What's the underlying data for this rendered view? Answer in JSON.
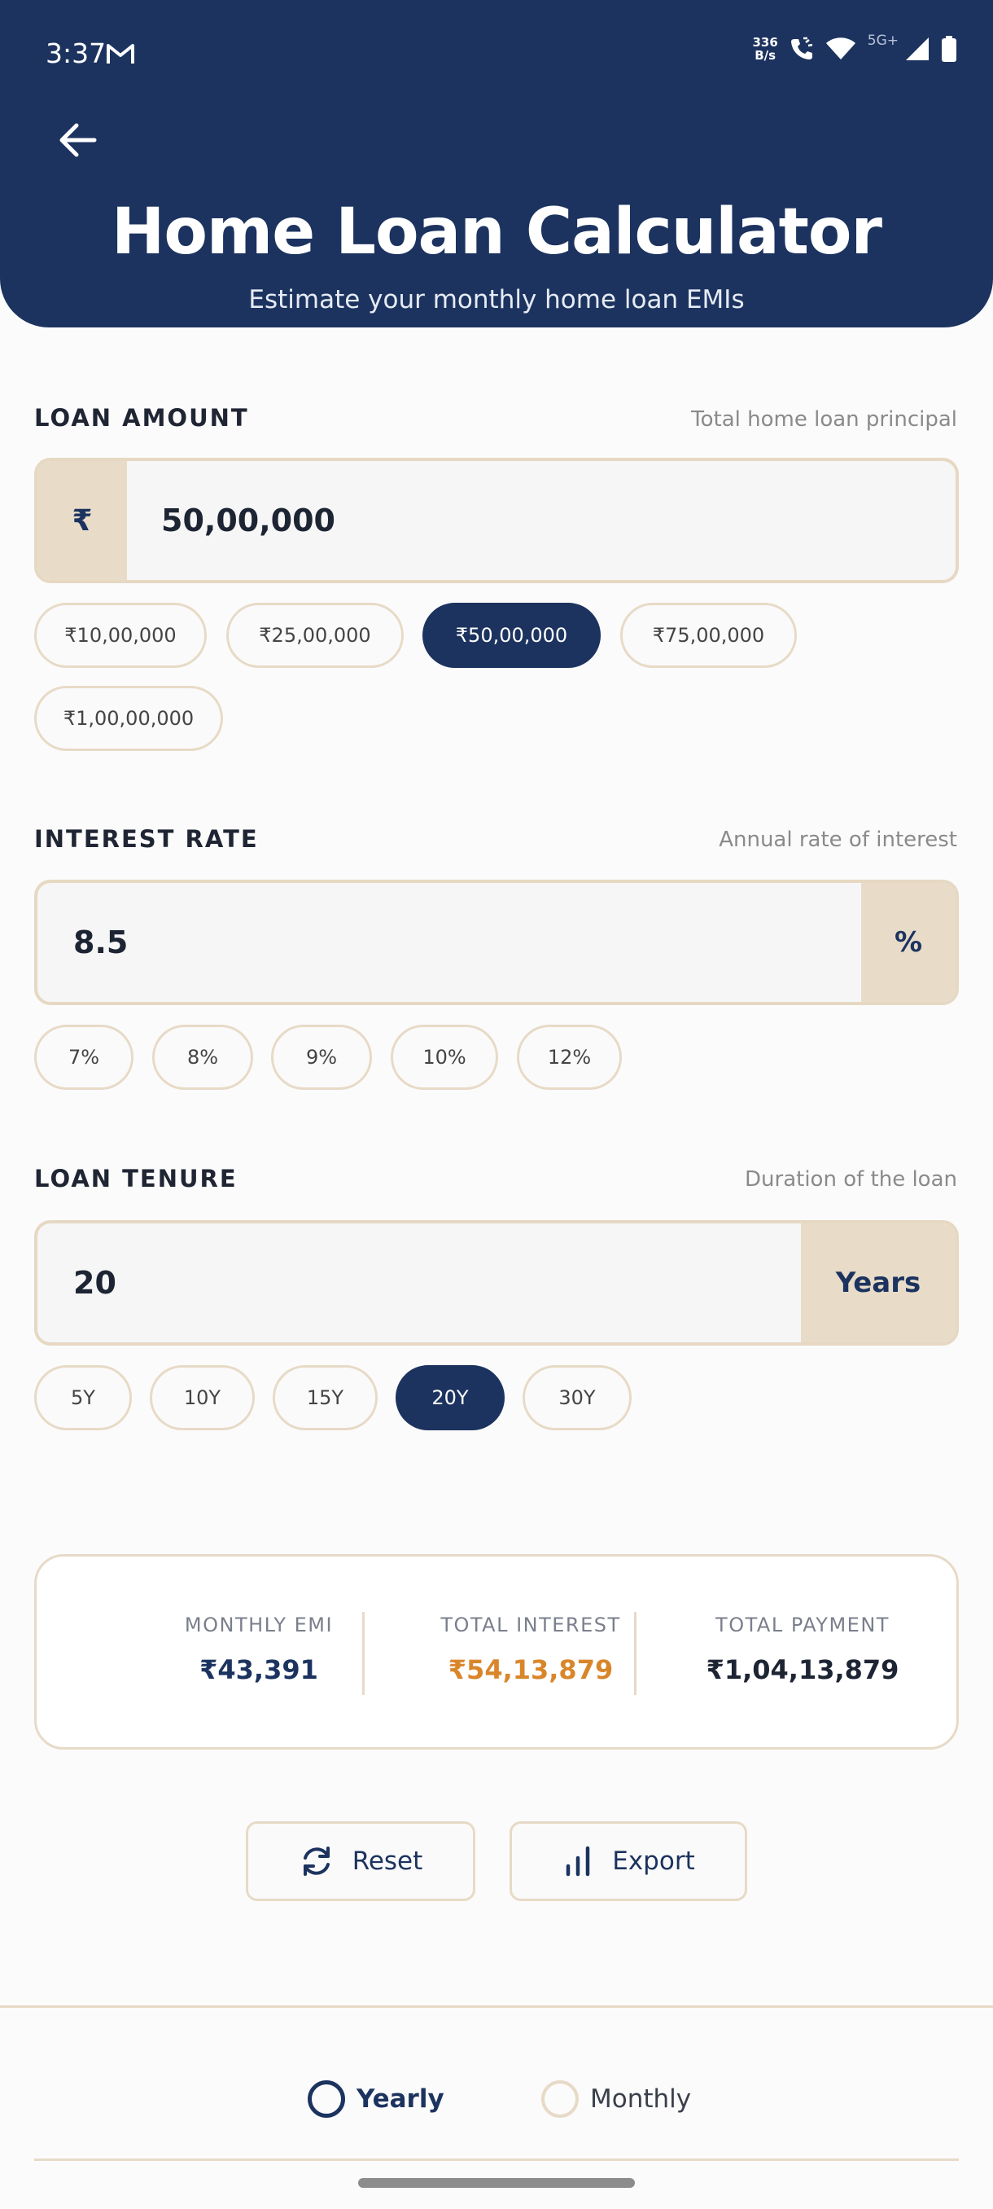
{
  "status_bar": {
    "time": "3:37",
    "net_speed_value": "336",
    "net_speed_unit": "B/s",
    "network_type": "5G+"
  },
  "header": {
    "title": "Home Loan Calculator",
    "subtitle": "Estimate your monthly home loan EMIs"
  },
  "loan_amount": {
    "label": "LOAN AMOUNT",
    "hint": "Total home loan principal",
    "currency_symbol": "₹",
    "value": "50,00,000",
    "presets": [
      "₹10,00,000",
      "₹25,00,000",
      "₹50,00,000",
      "₹75,00,000",
      "₹1,00,00,000"
    ],
    "selected_preset": "₹50,00,000"
  },
  "interest_rate": {
    "label": "INTEREST RATE",
    "hint": "Annual rate of interest",
    "value": "8.5",
    "unit": "%",
    "presets": [
      "7%",
      "8%",
      "9%",
      "10%",
      "12%"
    ],
    "selected_preset": ""
  },
  "loan_tenure": {
    "label": "LOAN TENURE",
    "hint": "Duration of the loan",
    "value": "20",
    "unit": "Years",
    "presets": [
      "5Y",
      "10Y",
      "15Y",
      "20Y",
      "30Y"
    ],
    "selected_preset": "20Y"
  },
  "results": {
    "monthly_emi_label": "MONTHLY EMI",
    "monthly_emi_value": "₹43,391",
    "total_interest_label": "TOTAL INTEREST",
    "total_interest_value": "₹54,13,879",
    "total_payment_label": "TOTAL PAYMENT",
    "total_payment_value": "₹1,04,13,879"
  },
  "actions": {
    "reset_label": "Reset",
    "export_label": "Export"
  },
  "schedule_toggle": {
    "yearly_label": "Yearly",
    "monthly_label": "Monthly",
    "selected": "Yearly"
  },
  "colors": {
    "primary": "#1c335f",
    "accent_orange": "#d9862b",
    "border_beige": "#e7dac6",
    "addon_beige": "#e8dcc9"
  }
}
